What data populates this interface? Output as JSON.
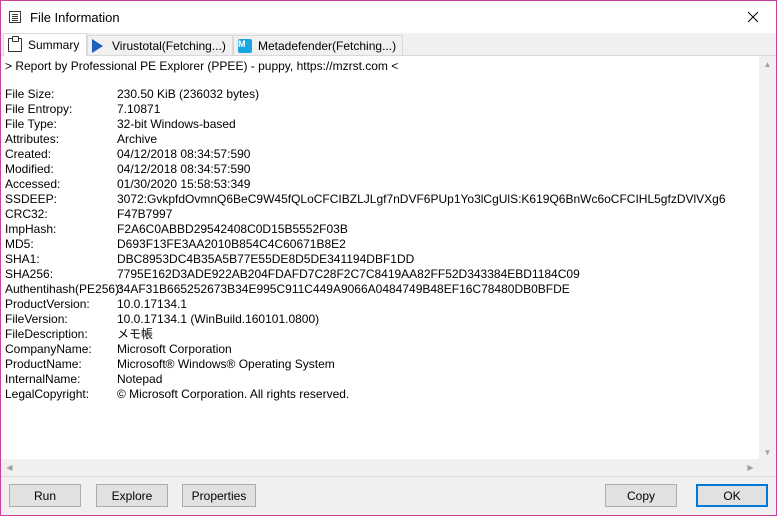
{
  "window": {
    "title": "File Information"
  },
  "tabs": [
    {
      "label": "Summary",
      "icon": "clipboard-icon",
      "active": true
    },
    {
      "label": "Virustotal(Fetching...)",
      "icon": "virustotal-icon",
      "active": false
    },
    {
      "label": "Metadefender(Fetching...)",
      "icon": "metadefender-icon",
      "icon_text": "M",
      "active": false
    }
  ],
  "report_header": "> Report by Professional PE Explorer (PPEE) - puppy, https://mzrst.com <",
  "fields": [
    {
      "key": "File Size:",
      "value": "230.50 KiB (236032  bytes)"
    },
    {
      "key": "File Entropy:",
      "value": "7.10871"
    },
    {
      "key": "File Type:",
      "value": "32-bit Windows-based"
    },
    {
      "key": "Attributes:",
      "value": "Archive"
    },
    {
      "key": "Created:",
      "value": "04/12/2018  08:34:57:590"
    },
    {
      "key": "Modified:",
      "value": "04/12/2018  08:34:57:590"
    },
    {
      "key": "Accessed:",
      "value": "01/30/2020  15:58:53:349"
    },
    {
      "key": "SSDEEP:",
      "value": "3072:GvkpfdOvmnQ6BeC9W45fQLoCFCIBZLJLgf7nDVF6PUp1Yo3lCgUlS:K619Q6BnWc6oCFCIHL5gfzDVlVXg6"
    },
    {
      "key": "CRC32:",
      "value": "F47B7997"
    },
    {
      "key": "ImpHash:",
      "value": "F2A6C0ABBD29542408C0D15B5552F03B"
    },
    {
      "key": "MD5:",
      "value": "D693F13FE3AA2010B854C4C60671B8E2"
    },
    {
      "key": "SHA1:",
      "value": "DBC8953DC4B35A5B77E55DE8D5DE341194DBF1DD"
    },
    {
      "key": "SHA256:",
      "value": "7795E162D3ADE922AB204FDAFD7C28F2C7C8419AA82FF52D343384EBD1184C09"
    },
    {
      "key": "Authentihash(PE256):",
      "value": "34AF31B665252673B34E995C911C449A9066A0484749B48EF16C78480DB0BFDE"
    },
    {
      "key": "ProductVersion:",
      "value": "10.0.17134.1"
    },
    {
      "key": "FileVersion:",
      "value": "10.0.17134.1 (WinBuild.160101.0800)"
    },
    {
      "key": "FileDescription:",
      "value": "メモ帳"
    },
    {
      "key": "CompanyName:",
      "value": "Microsoft Corporation"
    },
    {
      "key": "ProductName:",
      "value": "Microsoft® Windows® Operating System"
    },
    {
      "key": "InternalName:",
      "value": "Notepad"
    },
    {
      "key": "LegalCopyright:",
      "value": "© Microsoft Corporation. All rights reserved."
    }
  ],
  "buttons": {
    "run": "Run",
    "explore": "Explore",
    "properties": "Properties",
    "copy": "Copy",
    "ok": "OK"
  },
  "colors": {
    "window_border": "#c8419b",
    "default_button_border": "#0078d7",
    "virustotal_icon": "#1d5fbf",
    "metadefender_icon": "#19a5e0"
  }
}
